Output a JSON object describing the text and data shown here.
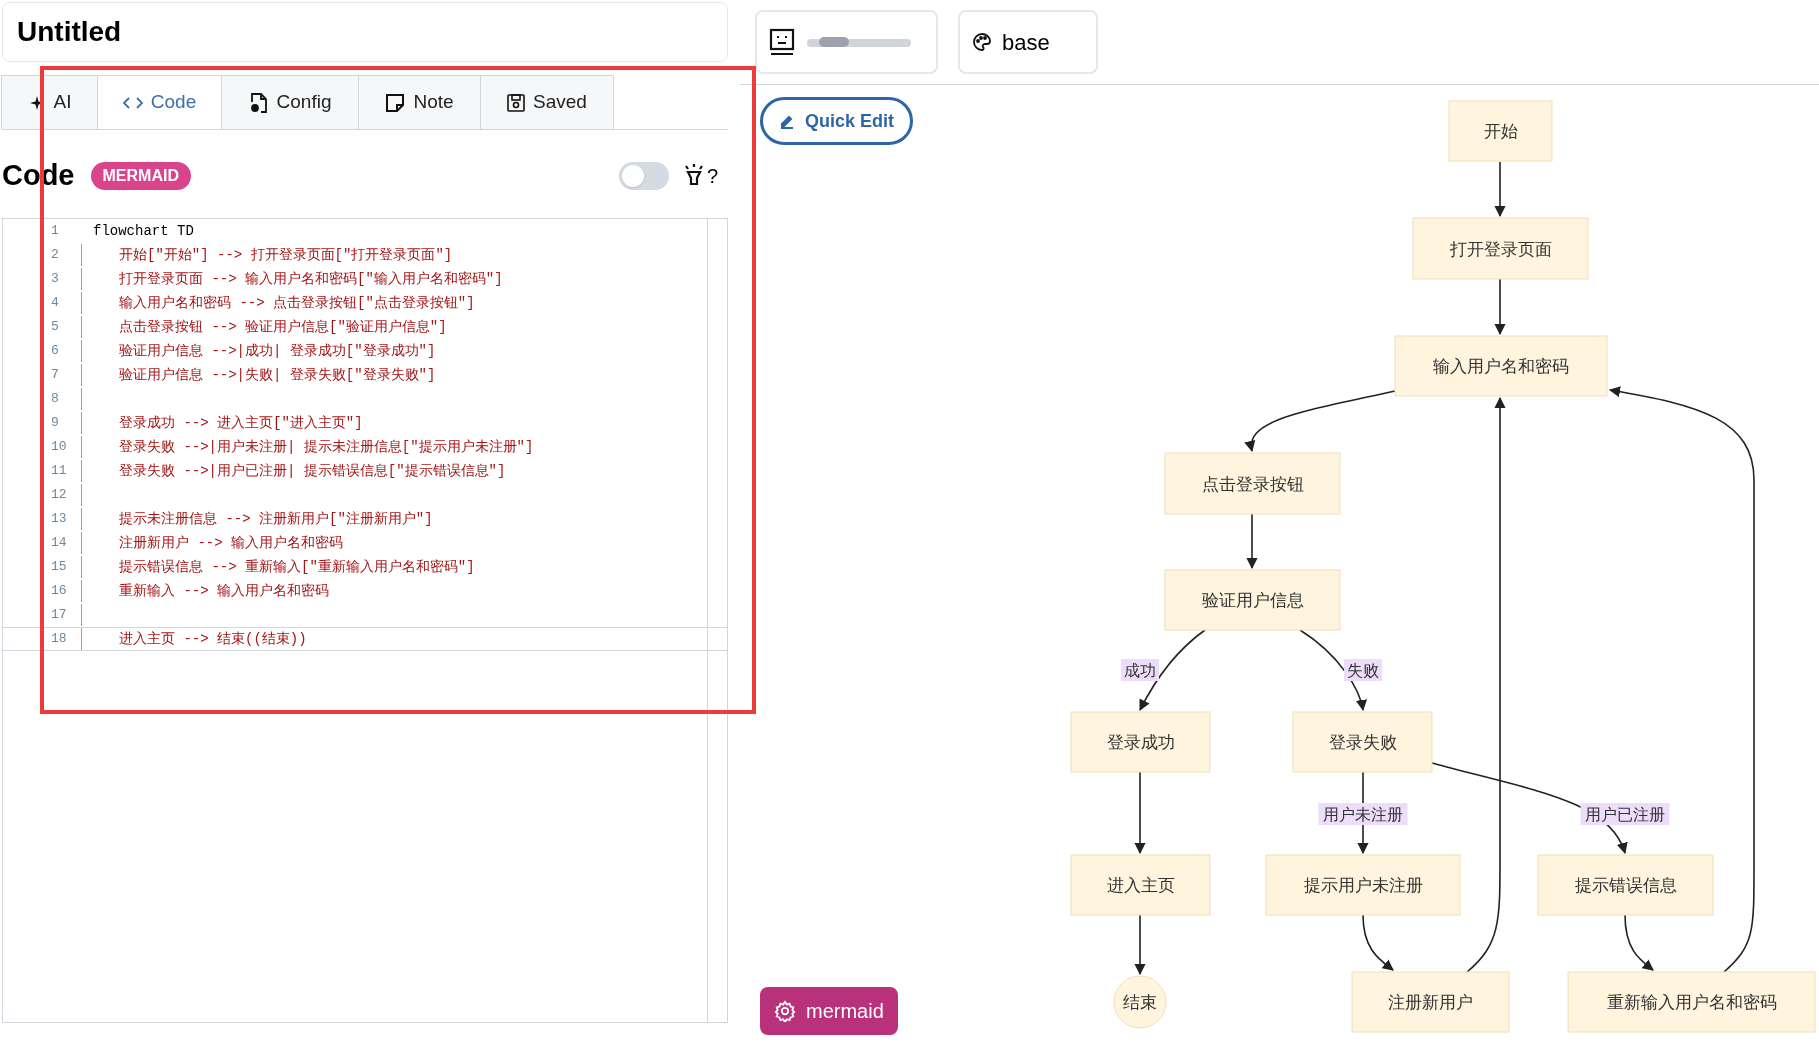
{
  "title": "Untitled",
  "tabs": [
    {
      "label": "AI",
      "selected": false
    },
    {
      "label": "Code",
      "selected": true
    },
    {
      "label": "Config",
      "selected": false
    },
    {
      "label": "Note",
      "selected": false
    },
    {
      "label": "Saved",
      "selected": false
    }
  ],
  "section": {
    "heading": "Code",
    "badge": "MERMAID",
    "toggle_on": false,
    "help": "?"
  },
  "editor": {
    "lines": [
      {
        "number": "1",
        "kind": "header",
        "text": "flowchart TD",
        "active": false
      },
      {
        "number": "2",
        "kind": "edge",
        "text": "开始[\"开始\"] --> 打开登录页面[\"打开登录页面\"]",
        "active": false
      },
      {
        "number": "3",
        "kind": "edge",
        "text": "打开登录页面 --> 输入用户名和密码[\"输入用户名和密码\"]",
        "active": false
      },
      {
        "number": "4",
        "kind": "edge",
        "text": "输入用户名和密码 --> 点击登录按钮[\"点击登录按钮\"]",
        "active": false
      },
      {
        "number": "5",
        "kind": "edge",
        "text": "点击登录按钮 --> 验证用户信息[\"验证用户信息\"]",
        "active": false
      },
      {
        "number": "6",
        "kind": "edge",
        "text": "验证用户信息 -->|成功| 登录成功[\"登录成功\"]",
        "active": false
      },
      {
        "number": "7",
        "kind": "edge",
        "text": "验证用户信息 -->|失败| 登录失败[\"登录失败\"]",
        "active": false
      },
      {
        "number": "8",
        "kind": "blank",
        "active": false
      },
      {
        "number": "9",
        "kind": "edge",
        "text": "登录成功 --> 进入主页[\"进入主页\"]",
        "active": false
      },
      {
        "number": "10",
        "kind": "edge",
        "text": "登录失败 -->|用户未注册| 提示未注册信息[\"提示用户未注册\"]",
        "active": false
      },
      {
        "number": "11",
        "kind": "edge",
        "text": "登录失败 -->|用户已注册| 提示错误信息[\"提示错误信息\"]",
        "active": false
      },
      {
        "number": "12",
        "kind": "blank",
        "active": false
      },
      {
        "number": "13",
        "kind": "edge",
        "text": "提示未注册信息 --> 注册新用户[\"注册新用户\"]",
        "active": false
      },
      {
        "number": "14",
        "kind": "edge",
        "text": "注册新用户 --> 输入用户名和密码",
        "active": false
      },
      {
        "number": "15",
        "kind": "edge",
        "text": "提示错误信息 --> 重新输入[\"重新输入用户名和密码\"]",
        "active": false
      },
      {
        "number": "16",
        "kind": "edge",
        "text": "重新输入 --> 输入用户名和密码",
        "active": false
      },
      {
        "number": "17",
        "kind": "blank",
        "active": false
      },
      {
        "number": "18",
        "kind": "edge",
        "text": "进入主页 --> 结束((结束))",
        "active": true
      }
    ]
  },
  "view_buttons": [
    {
      "kind": "redacted"
    },
    {
      "kind": "theme",
      "label": "base"
    }
  ],
  "quick_edit": "Quick Edit",
  "diagram": {
    "nodes": [
      {
        "label": "开始",
        "kind": "rect"
      },
      {
        "label": "打开登录页面",
        "kind": "rect"
      },
      {
        "label": "输入用户名和密码",
        "kind": "rect"
      },
      {
        "label": "点击登录按钮",
        "kind": "rect"
      },
      {
        "label": "验证用户信息",
        "kind": "rect"
      },
      {
        "label": "登录成功",
        "kind": "rect"
      },
      {
        "label": "登录失败",
        "kind": "rect"
      },
      {
        "label": "进入主页",
        "kind": "rect"
      },
      {
        "label": "提示用户未注册",
        "kind": "rect"
      },
      {
        "label": "提示错误信息",
        "kind": "rect"
      },
      {
        "label": "结束",
        "kind": "circle"
      },
      {
        "label": "注册新用户",
        "kind": "rect"
      },
      {
        "label": "重新输入用户名和密码",
        "kind": "rect"
      }
    ],
    "edge_labels": [
      "成功",
      "失败",
      "用户未注册",
      "用户已注册"
    ]
  },
  "mermaid_button": "mermaid"
}
